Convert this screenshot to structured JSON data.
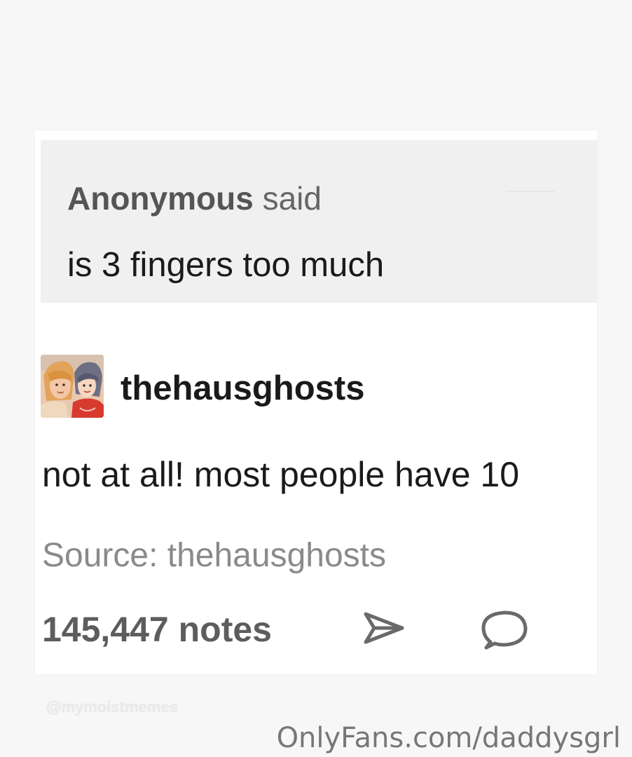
{
  "ask": {
    "asker_name": "Anonymous",
    "said_word": "said",
    "question": "is 3 fingers too much"
  },
  "answer": {
    "username": "thehausghosts",
    "avatar_icon": "avatar-two-cartoon-people-icon",
    "text": "not at all! most people have 10"
  },
  "source": {
    "text": "Source: thehausghosts"
  },
  "footer": {
    "notes": "145,447 notes",
    "share_icon": "share-arrow-icon",
    "comment_icon": "speech-bubble-icon"
  },
  "watermarks": {
    "small": "@mymoistmemes",
    "onlyfans": "OnlyFans.com/daddysgrl"
  },
  "colors": {
    "page_background": "#f7f7f7",
    "card_background": "#ffffff",
    "ask_background": "#f0f0f0",
    "primary_text": "#1a1a1a",
    "muted_text": "#8a8a8a"
  }
}
